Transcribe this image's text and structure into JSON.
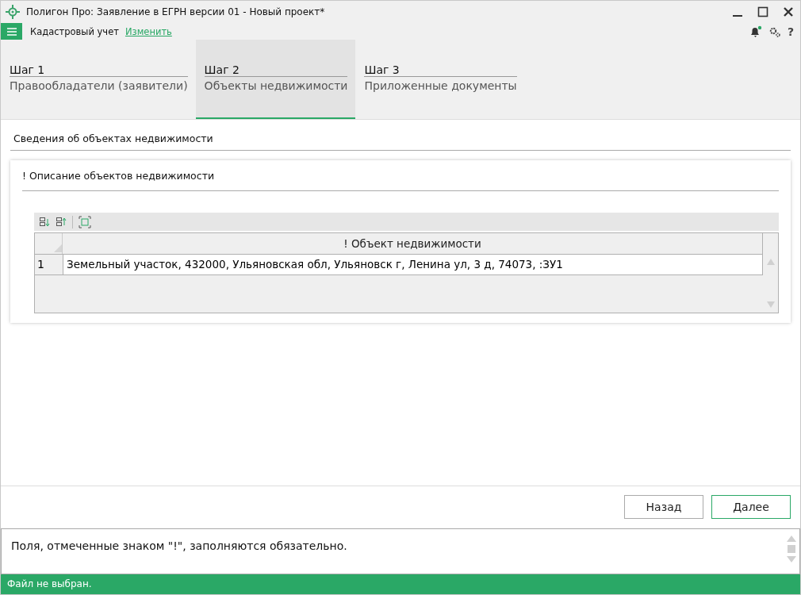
{
  "window": {
    "title": "Полигон Про: Заявление в ЕГРН версии 01 - Новый проект*"
  },
  "menu_bar": {
    "label": "Кадастровый учет",
    "link": "Изменить",
    "notification": true,
    "help": "?"
  },
  "steps": [
    {
      "number": "Шаг 1",
      "label": "Правообладатели (заявители)",
      "selected": false
    },
    {
      "number": "Шаг 2",
      "label": "Объекты недвижимости",
      "selected": true
    },
    {
      "number": "Шаг 3",
      "label": "Приложенные документы",
      "selected": false
    }
  ],
  "section": {
    "title": "Сведения об объектах недвижимости"
  },
  "card": {
    "title": "! Описание объектов недвижимости",
    "table": {
      "columns": [
        "! Объект недвижимости"
      ],
      "rows": [
        {
          "number": "1",
          "value": "Земельный участок, 432000, Ульяновская обл, Ульяновск г, Ленина ул, 3 д, 74073, :ЗУ1"
        }
      ]
    }
  },
  "buttons": [
    "Назад",
    "Далее"
  ],
  "message": "Поля, отмеченные знаком \"!\", заполняются обязательно.",
  "status_bar": "Файл не выбран."
}
